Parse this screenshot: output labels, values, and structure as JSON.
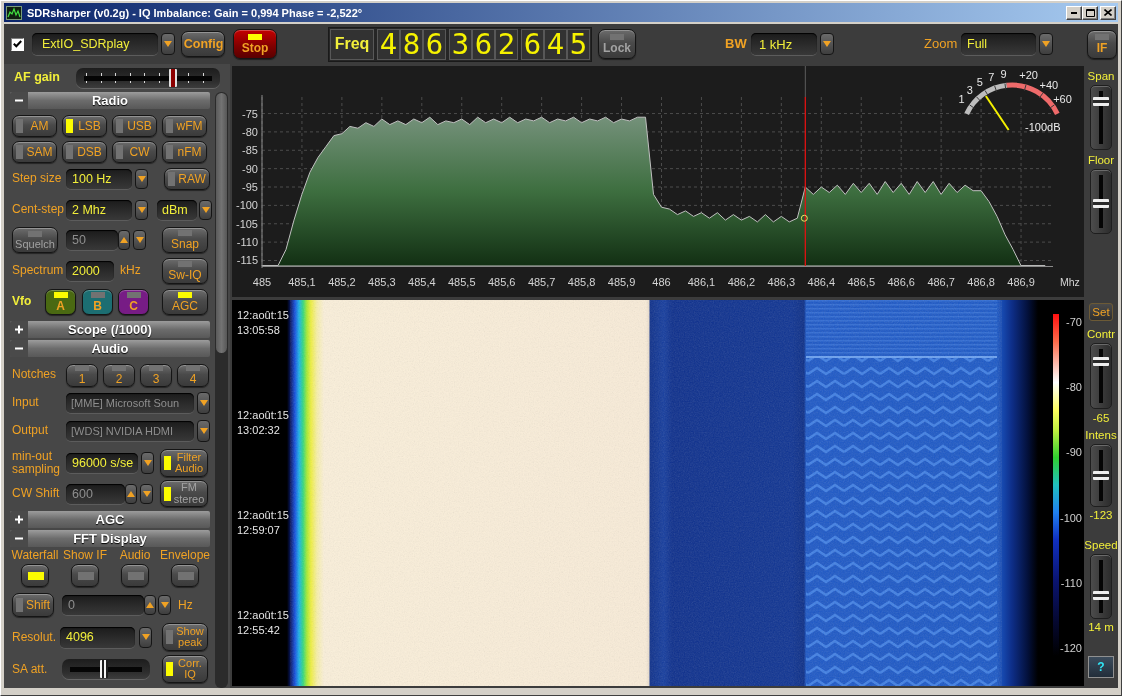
{
  "window": {
    "title": "SDRsharper (v0.2g) - IQ Imbalance: Gain = 0,994 Phase = -2,522°",
    "controls": [
      {
        "kind": "minimize"
      },
      {
        "kind": "maximize"
      },
      {
        "kind": "close"
      }
    ]
  },
  "toolbar": {
    "source": {
      "checked": true,
      "value": "ExtIO_SDRplay"
    },
    "config_button": {
      "label": "Config"
    },
    "stop_button": {
      "label": "Stop",
      "on": true
    },
    "frequency": {
      "label": "Freq",
      "digit_groups": [
        [
          "4",
          "8",
          "6"
        ],
        [
          "3",
          "6",
          "2"
        ],
        [
          "6",
          "4",
          "5"
        ]
      ]
    },
    "lock_button": {
      "label": "Lock",
      "on": false,
      "disabled": true
    },
    "bandwidth": {
      "label": "BW",
      "value": "1 kHz"
    },
    "zoom": {
      "label": "Zoom",
      "value": "Full"
    },
    "if_button": {
      "label": "IF",
      "on": false
    }
  },
  "af_gain": {
    "label": "AF gain",
    "level": 0.71
  },
  "radio": {
    "title": "Radio",
    "expanded": true,
    "modes": [
      {
        "label": "AM",
        "selected": false
      },
      {
        "label": "LSB",
        "selected": true
      },
      {
        "label": "USB",
        "selected": false
      },
      {
        "label": "wFM",
        "selected": false
      },
      {
        "label": "SAM",
        "selected": false
      },
      {
        "label": "DSB",
        "selected": false
      },
      {
        "label": "CW",
        "selected": false
      },
      {
        "label": "nFM",
        "selected": false
      }
    ],
    "raw_button": {
      "label": "RAW",
      "on": false
    },
    "step_size": {
      "label": "Step size",
      "value": "100 Hz"
    },
    "center_step": {
      "label": "Cent-step",
      "value": "2 Mhz"
    },
    "level_unit": {
      "value": "dBm"
    },
    "squelch_button": {
      "label": "Squelch",
      "on": false,
      "disabled": true
    },
    "squelch_level": {
      "value": "50",
      "disabled": true
    },
    "snap_button": {
      "label": "Snap",
      "on": false
    },
    "spectrum_width": {
      "label": "Spectrum",
      "value": "2000",
      "unit": "kHz"
    },
    "swap_iq_button": {
      "label": "Sw-IQ",
      "on": false
    },
    "vfo": {
      "label": "Vfo",
      "options": [
        {
          "label": "A",
          "selected": true,
          "color": "#4a6912"
        },
        {
          "label": "B",
          "selected": false,
          "color": "#1c6e72"
        },
        {
          "label": "C",
          "selected": false,
          "color": "#771c85"
        }
      ]
    },
    "agc_button": {
      "label": "AGC",
      "on": true
    }
  },
  "scope": {
    "title": "Scope (/1000)",
    "expanded": false
  },
  "audio": {
    "title": "Audio",
    "expanded": true,
    "notches": {
      "label": "Notches",
      "buttons": [
        {
          "label": "1",
          "on": false
        },
        {
          "label": "2",
          "on": false
        },
        {
          "label": "3",
          "on": false
        },
        {
          "label": "4",
          "on": false
        }
      ]
    },
    "input": {
      "label": "Input",
      "value": "[MME] Microsoft Soun",
      "disabled": true
    },
    "output": {
      "label": "Output",
      "value": "[WDS] NVIDIA HDMI",
      "disabled": true
    },
    "sampling": {
      "label": "min-out sampling",
      "value": "96000 s/se"
    },
    "filter_audio_button": {
      "label": "Filter Audio",
      "on": true
    },
    "cw_shift": {
      "label": "CW Shift",
      "value": "600",
      "disabled": true
    },
    "fm_stereo_button": {
      "label": "FM stereo",
      "on": true,
      "disabled": true
    }
  },
  "agc": {
    "title": "AGC",
    "expanded": false
  },
  "fft_display": {
    "title": "FFT Display",
    "expanded": true,
    "views": [
      {
        "label": "Waterfall",
        "on": true
      },
      {
        "label": "Show IF",
        "on": false
      },
      {
        "label": "Audio",
        "on": false
      },
      {
        "label": "Envelope",
        "on": false
      }
    ],
    "shift_button": {
      "label": "Shift",
      "on": false
    },
    "shift": {
      "value": "0",
      "unit": "Hz",
      "disabled": true
    },
    "resolution": {
      "label": "Resolut.",
      "value": "4096"
    },
    "show_peak_button": {
      "label": "Show peak",
      "on": false
    },
    "sa_att": {
      "label": "SA att.",
      "level": 0.47
    },
    "corr_iq_button": {
      "label": "Corr. IQ",
      "on": true
    }
  },
  "spectrum": {
    "chart_data": {
      "type": "area",
      "xlabel": "Mhz",
      "grid": true,
      "x": [
        485,
        485.02,
        485.04,
        485.06,
        485.08,
        485.1,
        485.12,
        485.14,
        485.16,
        485.18,
        485.2,
        485.22,
        485.24,
        485.26,
        485.28,
        485.3,
        485.32,
        485.34,
        485.36,
        485.38,
        485.4,
        485.42,
        485.44,
        485.46,
        485.48,
        485.5,
        485.52,
        485.54,
        485.56,
        485.58,
        485.6,
        485.62,
        485.64,
        485.66,
        485.68,
        485.7,
        485.72,
        485.74,
        485.76,
        485.78,
        485.8,
        485.82,
        485.84,
        485.86,
        485.88,
        485.9,
        485.92,
        485.94,
        485.96,
        485.98,
        486,
        486.02,
        486.04,
        486.06,
        486.08,
        486.1,
        486.12,
        486.14,
        486.16,
        486.18,
        486.2,
        486.22,
        486.24,
        486.26,
        486.28,
        486.3,
        486.32,
        486.34,
        486.36,
        486.38,
        486.4,
        486.42,
        486.44,
        486.46,
        486.48,
        486.5,
        486.52,
        486.54,
        486.56,
        486.58,
        486.6,
        486.62,
        486.64,
        486.66,
        486.68,
        486.7,
        486.72,
        486.74,
        486.76,
        486.78,
        486.8,
        486.82,
        486.84,
        486.86,
        486.88,
        486.9,
        486.92,
        486.94,
        486.96
      ],
      "series": [
        {
          "color": "#c0c0c0",
          "values": [
            -116.4,
            -116.4,
            -116.4,
            -112,
            -104,
            -97,
            -91,
            -87,
            -84,
            -81,
            -80.5,
            -78.5,
            -79,
            -77.5,
            -78.5,
            -76.5,
            -78,
            -77,
            -78,
            -76.5,
            -77.5,
            -76,
            -78,
            -77,
            -77.5,
            -76.5,
            -78,
            -76,
            -77.5,
            -76.5,
            -77.5,
            -76,
            -77.5,
            -76.5,
            -77,
            -76,
            -77.5,
            -76.5,
            -77,
            -76,
            -77.5,
            -76.5,
            -77,
            -76,
            -77.5,
            -76.5,
            -77,
            -76,
            -76,
            -97,
            -100.5,
            -101,
            -102.5,
            -101.5,
            -103,
            -102,
            -103.5,
            -102,
            -104,
            -102.5,
            -104,
            -103,
            -104.5,
            -102.5,
            -104.5,
            -103,
            -104.5,
            -103.5,
            -95,
            -97,
            -95,
            -96.5,
            -94.5,
            -97,
            -94,
            -96.5,
            -94,
            -97,
            -93.5,
            -96.5,
            -94,
            -97,
            -93.5,
            -96.5,
            -93.5,
            -97,
            -94,
            -96.5,
            -94.5,
            -96,
            -96,
            -99,
            -103,
            -108,
            -112,
            -116.4,
            -116.4,
            -116.4,
            -116.4
          ]
        }
      ],
      "xlim": [
        485,
        486.98
      ],
      "ylim": [
        -116.5,
        -70.5
      ],
      "xticks": [
        {
          "value": 485,
          "label": "485"
        },
        {
          "value": 485.1,
          "label": "485,1"
        },
        {
          "value": 485.2,
          "label": "485,2"
        },
        {
          "value": 485.3,
          "label": "485,3"
        },
        {
          "value": 485.4,
          "label": "485,4"
        },
        {
          "value": 485.5,
          "label": "485,5"
        },
        {
          "value": 485.6,
          "label": "485,6"
        },
        {
          "value": 485.7,
          "label": "485,7"
        },
        {
          "value": 485.8,
          "label": "485,8"
        },
        {
          "value": 485.9,
          "label": "485,9"
        },
        {
          "value": 486,
          "label": "486"
        },
        {
          "value": 486.1,
          "label": "486,1"
        },
        {
          "value": 486.2,
          "label": "486,2"
        },
        {
          "value": 486.3,
          "label": "486,3"
        },
        {
          "value": 486.4,
          "label": "486,4"
        },
        {
          "value": 486.5,
          "label": "486,5"
        },
        {
          "value": 486.6,
          "label": "486,6"
        },
        {
          "value": 486.7,
          "label": "486,7"
        },
        {
          "value": 486.8,
          "label": "486,8"
        },
        {
          "value": 486.9,
          "label": "486,9"
        }
      ],
      "yticks": [
        -75,
        -80,
        -85,
        -90,
        -95,
        -100,
        -105,
        -110,
        -115
      ],
      "ref_lines": [
        {
          "axis": "x",
          "value": 486.36,
          "color": "#e01212"
        }
      ]
    },
    "s_meter": {
      "scale": [
        "1",
        "3",
        "5",
        "7",
        "9",
        "+20",
        "+40",
        "+60"
      ],
      "level": 0.24,
      "reading": "-100dB"
    }
  },
  "waterfall": {
    "timestamps": [
      {
        "date": "12:août:15",
        "time": "13:05:58"
      },
      {
        "date": "12:août:15",
        "time": "13:02:32"
      },
      {
        "date": "12:août:15",
        "time": "12:59:07"
      },
      {
        "date": "12:août:15",
        "time": "12:55:42"
      }
    ],
    "scale": [
      "-70",
      "-80",
      "-90",
      "-100",
      "-110",
      "-120"
    ]
  },
  "right_panel": {
    "span": {
      "label": "Span",
      "level": 0.85
    },
    "floor": {
      "label": "Floor",
      "level": 0.45
    },
    "set_button": {
      "label": "Set"
    },
    "contrast": {
      "label": "Contr",
      "level": 0.8,
      "reading": "-65"
    },
    "intensity": {
      "label": "Intens",
      "level": 0.5,
      "reading": "-123"
    },
    "speed": {
      "label": "Speed",
      "level": 0.3,
      "reading": "14 m"
    },
    "help_button": {
      "label": "?"
    }
  }
}
